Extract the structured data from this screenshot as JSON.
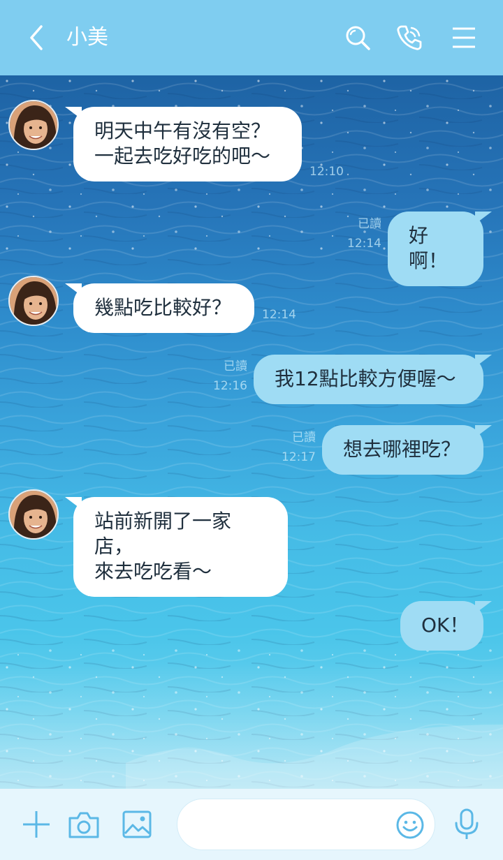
{
  "header": {
    "title": "小美",
    "back_icon": "chevron-left-icon",
    "actions": [
      "search-icon",
      "phone-icon",
      "menu-icon"
    ],
    "background": "#7fcdf0"
  },
  "messages": [
    {
      "from": "contact",
      "text": "明天中午有沒有空？\n一起去吃好吃的吧～",
      "time": "12:10"
    },
    {
      "from": "me",
      "text": "好啊！",
      "read": "已讀",
      "time": "12:14"
    },
    {
      "from": "contact",
      "text": "幾點吃比較好？",
      "time": "12:14"
    },
    {
      "from": "me",
      "text": "我12點比較方便喔～",
      "read": "已讀",
      "time": "12:16"
    },
    {
      "from": "me",
      "text": "想去哪裡吃？",
      "read": "已讀",
      "time": "12:17"
    },
    {
      "from": "contact",
      "text": "站前新開了一家店，\n來去吃吃看～",
      "time": ""
    },
    {
      "from": "me",
      "text": "OK！",
      "read": "",
      "time": ""
    }
  ],
  "input_bar": {
    "placeholder": "",
    "icons": [
      "plus-icon",
      "camera-icon",
      "image-icon",
      "emoji-icon",
      "microphone-icon"
    ],
    "background": "#e6f6fd"
  },
  "colors": {
    "incoming_bubble": "#ffffff",
    "outgoing_bubble": "#9fdcf4",
    "text": "#1f2f3d",
    "icon_blue": "#5bb8e6"
  }
}
